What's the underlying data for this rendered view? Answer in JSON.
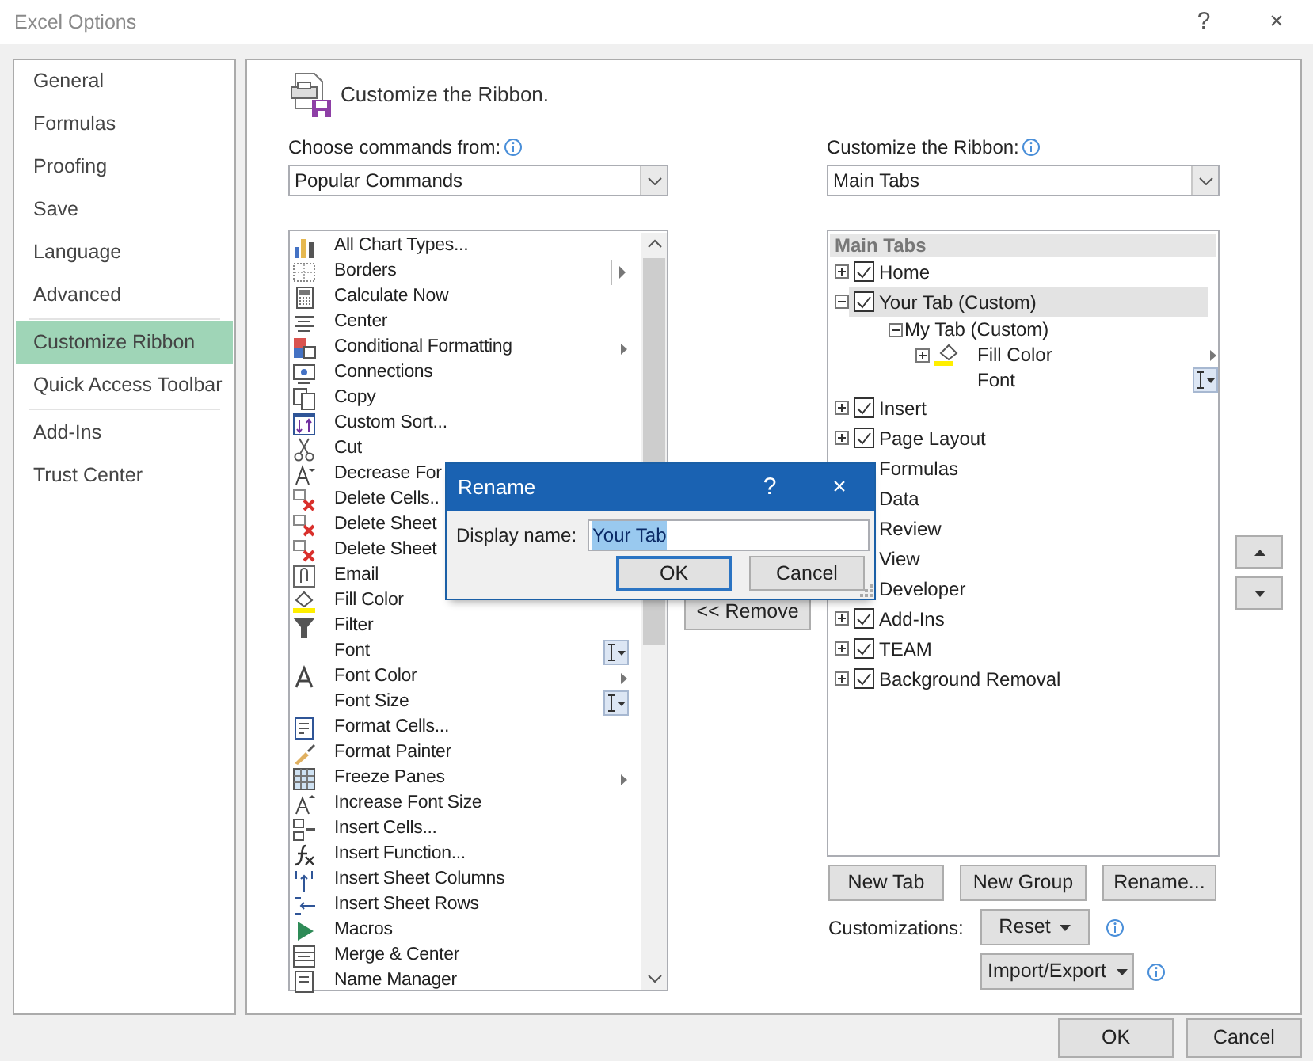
{
  "window": {
    "title": "Excel Options",
    "help": "?",
    "close": "×"
  },
  "sidebar": {
    "groups": [
      [
        {
          "label": "General",
          "selected": false
        },
        {
          "label": "Formulas",
          "selected": false
        },
        {
          "label": "Proofing",
          "selected": false
        },
        {
          "label": "Save",
          "selected": false
        },
        {
          "label": "Language",
          "selected": false
        },
        {
          "label": "Advanced",
          "selected": false
        }
      ],
      [
        {
          "label": "Customize Ribbon",
          "selected": true
        },
        {
          "label": "Quick Access Toolbar",
          "selected": false
        }
      ],
      [
        {
          "label": "Add-Ins",
          "selected": false
        },
        {
          "label": "Trust Center",
          "selected": false
        }
      ]
    ]
  },
  "page": {
    "title": "Customize the Ribbon.",
    "commands": {
      "label": "Choose commands from:",
      "value": "Popular Commands",
      "items": [
        {
          "kind": "plain",
          "label": "All Chart Types..."
        },
        {
          "kind": "split-submenu",
          "label": "Borders"
        },
        {
          "kind": "plain",
          "label": "Calculate Now"
        },
        {
          "kind": "plain",
          "label": "Center"
        },
        {
          "kind": "submenu",
          "label": "Conditional Formatting"
        },
        {
          "kind": "plain",
          "label": "Connections"
        },
        {
          "kind": "plain",
          "label": "Copy"
        },
        {
          "kind": "plain",
          "label": "Custom Sort..."
        },
        {
          "kind": "plain",
          "label": "Cut"
        },
        {
          "kind": "plain",
          "label": "Decrease For"
        },
        {
          "kind": "plain",
          "label": "Delete Cells.."
        },
        {
          "kind": "plain",
          "label": "Delete Sheet"
        },
        {
          "kind": "plain",
          "label": "Delete Sheet"
        },
        {
          "kind": "plain",
          "label": "Email"
        },
        {
          "kind": "plain",
          "label": "Fill Color"
        },
        {
          "kind": "plain",
          "label": "Filter"
        },
        {
          "kind": "picker",
          "label": "Font"
        },
        {
          "kind": "submenu",
          "label": "Font Color"
        },
        {
          "kind": "picker",
          "label": "Font Size"
        },
        {
          "kind": "plain",
          "label": "Format Cells..."
        },
        {
          "kind": "plain",
          "label": "Format Painter"
        },
        {
          "kind": "submenu",
          "label": "Freeze Panes"
        },
        {
          "kind": "plain",
          "label": "Increase Font Size"
        },
        {
          "kind": "plain",
          "label": "Insert Cells..."
        },
        {
          "kind": "plain",
          "label": "Insert Function..."
        },
        {
          "kind": "plain",
          "label": "Insert Sheet Columns"
        },
        {
          "kind": "plain",
          "label": "Insert Sheet Rows"
        },
        {
          "kind": "plain",
          "label": "Macros"
        },
        {
          "kind": "plain",
          "label": "Merge & Center"
        },
        {
          "kind": "plain",
          "label": "Name Manager"
        }
      ]
    },
    "remove_button": "<< Remove",
    "ribbon": {
      "label": "Customize the Ribbon:",
      "value": "Main Tabs",
      "tree_header": "Main Tabs",
      "tree": [
        {
          "kind": "tab",
          "label": "Home",
          "expanded": false,
          "checked": true,
          "selected": false
        },
        {
          "kind": "tab",
          "label": "Your Tab (Custom)",
          "expanded": true,
          "checked": true,
          "selected": true,
          "children": [
            {
              "kind": "group",
              "label": "My Tab (Custom)",
              "expanded": true,
              "selected": false,
              "children": [
                {
                  "kind": "submenu-command",
                  "label": "Fill Color",
                  "expanded": false,
                  "selected": false
                },
                {
                  "kind": "picker-command",
                  "label": "Font",
                  "selected": false
                }
              ]
            }
          ]
        },
        {
          "kind": "tab",
          "label": "Insert",
          "expanded": false,
          "checked": true,
          "selected": false
        },
        {
          "kind": "tab",
          "label": "Page Layout",
          "expanded": false,
          "checked": true,
          "selected": false
        },
        {
          "kind": "tab",
          "label": "Formulas",
          "selected": false
        },
        {
          "kind": "tab",
          "label": "Data",
          "selected": false
        },
        {
          "kind": "tab",
          "label": "Review",
          "selected": false
        },
        {
          "kind": "tab",
          "label": "View",
          "selected": false
        },
        {
          "kind": "tab",
          "label": "Developer",
          "selected": false
        },
        {
          "kind": "tab",
          "label": "Add-Ins",
          "expanded": false,
          "checked": true,
          "selected": false
        },
        {
          "kind": "tab",
          "label": "TEAM",
          "expanded": false,
          "checked": true,
          "selected": false
        },
        {
          "kind": "tab",
          "label": "Background Removal",
          "expanded": false,
          "checked": true,
          "selected": false
        }
      ]
    },
    "ribbon_buttons": [
      "New Tab",
      "New Group",
      "Rename..."
    ],
    "customizations": {
      "label": "Customizations:",
      "reset": "Reset",
      "import_export": "Import/Export"
    }
  },
  "dialog": {
    "title": "Rename",
    "help": "?",
    "close": "×",
    "field_label": "Display name:",
    "value": "Your Tab",
    "text_selected": true,
    "buttons": [
      {
        "label": "OK",
        "default": true
      },
      {
        "label": "Cancel",
        "default": false
      }
    ]
  },
  "footer": {
    "buttons": [
      "OK",
      "Cancel"
    ]
  }
}
